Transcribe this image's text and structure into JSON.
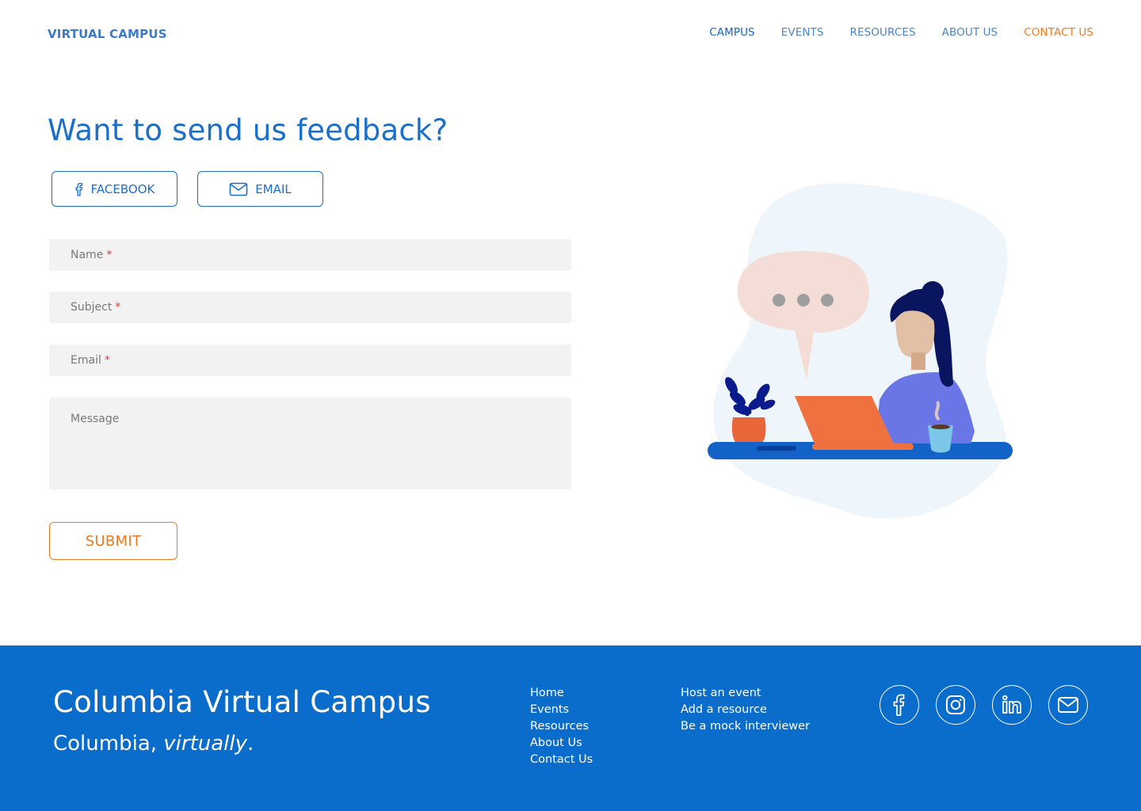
{
  "header": {
    "brand": "VIRTUAL CAMPUS",
    "nav": [
      {
        "label": "CAMPUS",
        "state": "active"
      },
      {
        "label": "EVENTS",
        "state": "default"
      },
      {
        "label": "RESOURCES",
        "state": "default"
      },
      {
        "label": "ABOUT US",
        "state": "default"
      },
      {
        "label": "CONTACT US",
        "state": "current"
      }
    ]
  },
  "main": {
    "title": "Want to send us feedback?",
    "social_buttons": [
      {
        "label": "FACEBOOK",
        "icon": "facebook-icon"
      },
      {
        "label": "EMAIL",
        "icon": "mail-icon"
      }
    ],
    "form": {
      "name_placeholder": "Name",
      "subject_placeholder": "Subject",
      "email_placeholder": "Email",
      "message_placeholder": "Message",
      "required_mark": "*",
      "submit_label": "SUBMIT"
    }
  },
  "footer": {
    "title": "Columbia Virtual Campus",
    "tagline_prefix": "Columbia, ",
    "tagline_emphasis": "virtually",
    "tagline_suffix": ".",
    "links_col1": [
      "Home",
      "Events",
      "Resources",
      "About Us",
      "Contact Us"
    ],
    "links_col2": [
      "Host an event",
      "Add a resource",
      "Be a mock interviewer"
    ],
    "social_icons": [
      "facebook-icon",
      "instagram-icon",
      "linkedin-icon",
      "mail-icon"
    ]
  },
  "colors": {
    "primary_blue": "#1a6fcb",
    "footer_blue": "#0a6ccb",
    "accent_orange": "#ef7a1d",
    "field_bg": "#f2f2f2",
    "required_red": "#e23b3b"
  }
}
